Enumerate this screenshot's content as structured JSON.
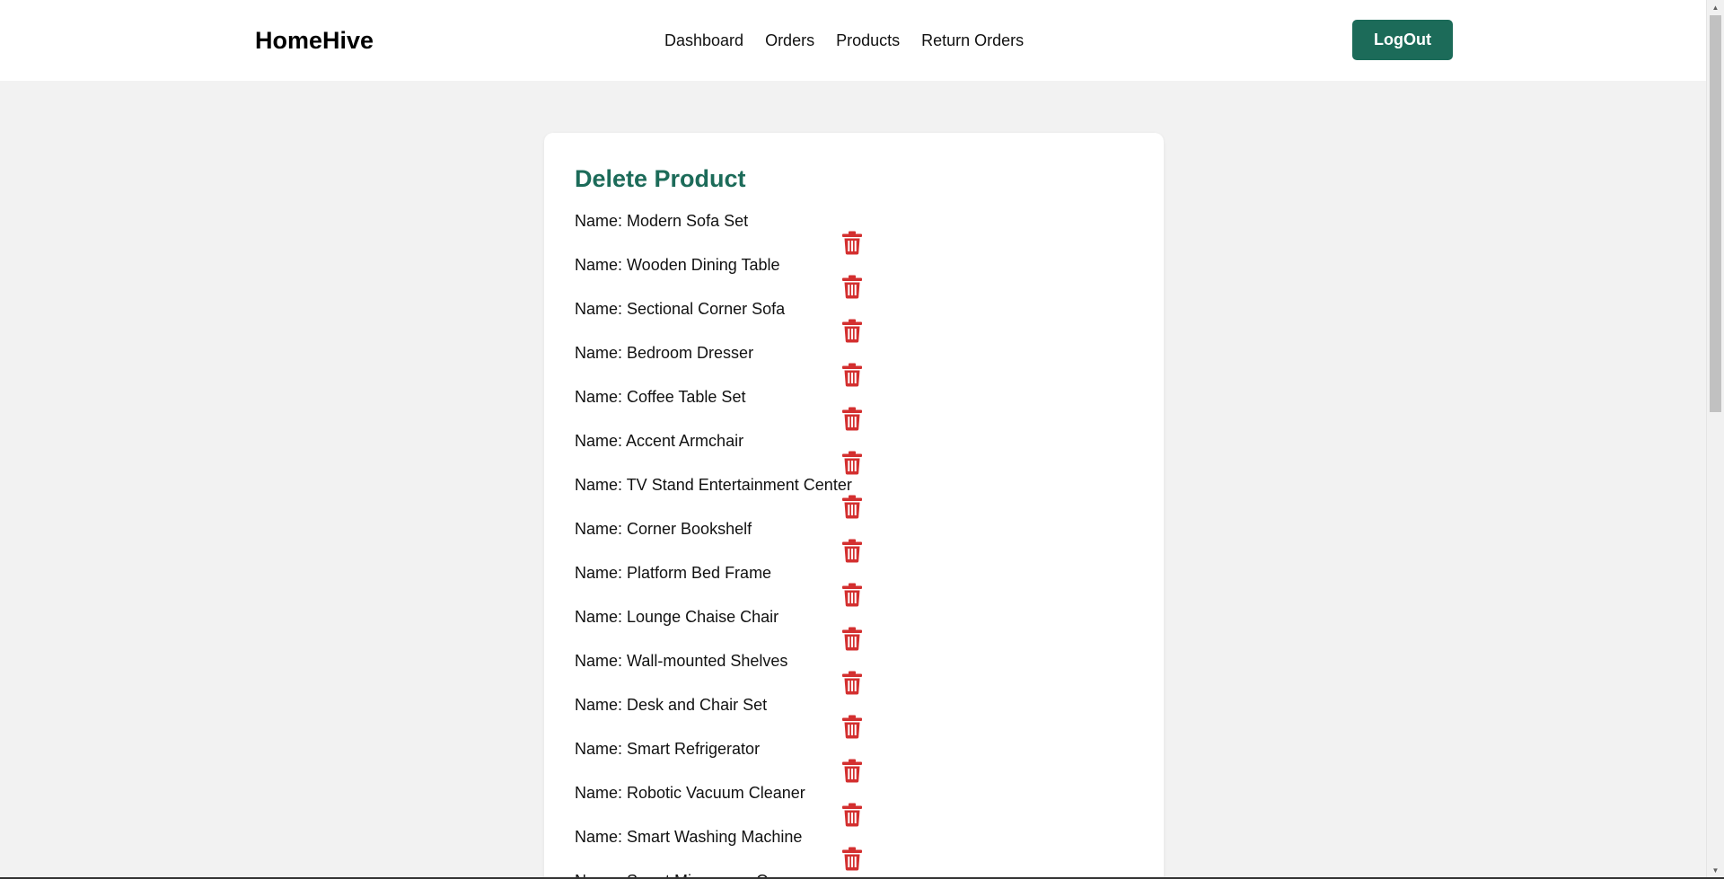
{
  "app": {
    "brand": "HomeHive"
  },
  "nav": {
    "links": [
      {
        "label": "Dashboard"
      },
      {
        "label": "Orders"
      },
      {
        "label": "Products"
      },
      {
        "label": "Return Orders"
      }
    ],
    "logout_label": "LogOut"
  },
  "card": {
    "title": "Delete Product"
  },
  "products": [
    {
      "name": "Name: Modern Sofa Set"
    },
    {
      "name": "Name: Wooden Dining Table"
    },
    {
      "name": "Name: Sectional Corner Sofa"
    },
    {
      "name": "Name: Bedroom Dresser"
    },
    {
      "name": "Name: Coffee Table Set"
    },
    {
      "name": "Name: Accent Armchair"
    },
    {
      "name": "Name: TV Stand Entertainment Center"
    },
    {
      "name": "Name: Corner Bookshelf"
    },
    {
      "name": "Name: Platform Bed Frame"
    },
    {
      "name": "Name: Lounge Chaise Chair"
    },
    {
      "name": "Name: Wall-mounted Shelves"
    },
    {
      "name": "Name: Desk and Chair Set"
    },
    {
      "name": "Name: Smart Refrigerator"
    },
    {
      "name": "Name: Robotic Vacuum Cleaner"
    },
    {
      "name": "Name: Smart Washing Machine"
    },
    {
      "name": "Name: Smart Microwave Oven"
    }
  ],
  "icons": {
    "delete": "trash-icon"
  },
  "colors": {
    "brand_green": "#1c6b59",
    "delete_red": "#d32f2f",
    "page_bg": "#f2f2f2"
  }
}
